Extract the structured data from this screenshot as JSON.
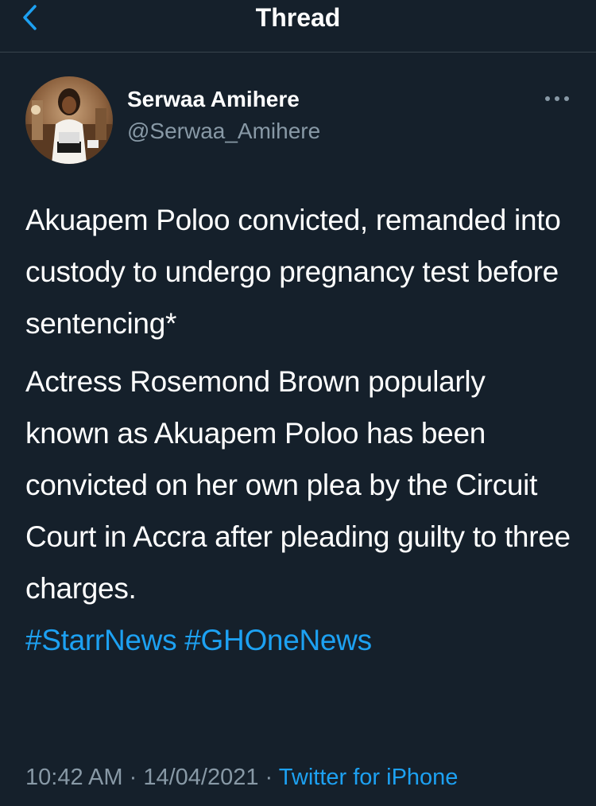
{
  "header": {
    "title": "Thread",
    "back_icon": "chevron-left-icon"
  },
  "colors": {
    "background": "#15202b",
    "accent": "#1da1f2",
    "secondary_text": "#8899a6",
    "divider": "#38444d"
  },
  "tweet": {
    "author": {
      "display_name": "Serwaa Amihere",
      "handle": "@Serwaa_Amihere"
    },
    "more_icon": "more-horizontal-icon",
    "paragraphs": [
      "Akuapem Poloo convicted, remanded into custody to undergo pregnancy test before sentencing*",
      "Actress Rosemond Brown popularly known as Akuapem Poloo has been convicted on her own plea by the Circuit Court in Accra after pleading guilty to three charges."
    ],
    "hashtags": [
      "#StarrNews",
      "#GHOneNews"
    ],
    "time": "10:42 AM",
    "separator": "·",
    "date": "14/04/2021",
    "source": "Twitter for iPhone"
  }
}
